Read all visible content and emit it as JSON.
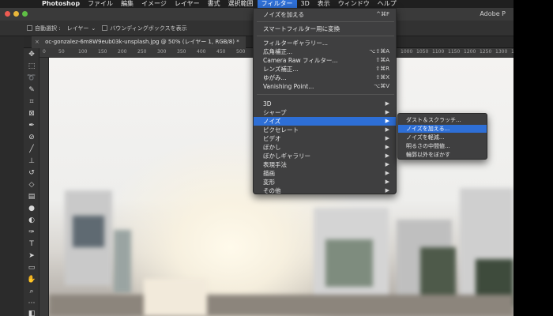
{
  "menubar": {
    "apple": "",
    "app_name": "Photoshop",
    "items": [
      "ファイル",
      "編集",
      "イメージ",
      "レイヤー",
      "書式",
      "選択範囲",
      "フィルター",
      "3D",
      "表示",
      "ウィンドウ",
      "ヘルプ"
    ]
  },
  "window": {
    "app_title": "Adobe P",
    "traffic_light_colors": [
      "#ee5b52",
      "#e9b73a",
      "#5fbf45"
    ]
  },
  "options_bar": {
    "auto_select_label": "自動選択 :",
    "auto_select_value": "レイヤー",
    "bbox_label": "バウンディングボックスを表示"
  },
  "document_tab": {
    "close": "×",
    "title": "oc-gonzalez-6m8W9eub03k-unsplash.jpg @ 50% (レイヤー 1, RGB/8) *"
  },
  "ruler": {
    "ticks": [
      "0",
      "50",
      "100",
      "150",
      "200",
      "250",
      "300",
      "350",
      "400",
      "450",
      "500",
      "550",
      "1000",
      "1050",
      "1100",
      "1150",
      "1200",
      "1250",
      "1300",
      "1350",
      "1400",
      "1450"
    ]
  },
  "tools": [
    "move-tool",
    "marquee-tool",
    "lasso-tool",
    "magic-wand-tool",
    "crop-tool",
    "frame-tool",
    "eyedropper-tool",
    "healing-brush-tool",
    "brush-tool",
    "clone-stamp-tool",
    "history-brush-tool",
    "eraser-tool",
    "gradient-tool",
    "blur-tool",
    "dodge-tool",
    "pen-tool",
    "type-tool",
    "path-selection-tool",
    "rectangle-tool",
    "hand-tool",
    "zoom-tool",
    "more-tools",
    "color-swatches"
  ],
  "filter_menu": {
    "items": [
      {
        "label": "ノイズを加える",
        "shortcut": "^⌘F"
      },
      {
        "label": "スマートフィルター用に変換",
        "shortcut": ""
      },
      {
        "label": "フィルターギャラリー...",
        "shortcut": ""
      },
      {
        "label": "広角補正...",
        "shortcut": "⌥⇧⌘A"
      },
      {
        "label": "Camera Raw フィルター...",
        "shortcut": "⇧⌘A"
      },
      {
        "label": "レンズ補正...",
        "shortcut": "⇧⌘R"
      },
      {
        "label": "ゆがみ...",
        "shortcut": "⇧⌘X"
      },
      {
        "label": "Vanishing Point...",
        "shortcut": "⌥⌘V"
      },
      {
        "label": "3D",
        "shortcut": ""
      },
      {
        "label": "シャープ",
        "shortcut": ""
      },
      {
        "label": "ノイズ",
        "shortcut": ""
      },
      {
        "label": "ピクセレート",
        "shortcut": ""
      },
      {
        "label": "ビデオ",
        "shortcut": ""
      },
      {
        "label": "ぼかし",
        "shortcut": ""
      },
      {
        "label": "ぼかしギャラリー",
        "shortcut": ""
      },
      {
        "label": "表現手法",
        "shortcut": ""
      },
      {
        "label": "描画",
        "shortcut": ""
      },
      {
        "label": "変形",
        "shortcut": ""
      },
      {
        "label": "その他",
        "shortcut": ""
      }
    ],
    "submenu_arrow": "▶"
  },
  "noise_submenu": {
    "items": [
      "ダスト＆スクラッチ...",
      "ノイズを加える...",
      "ノイズを軽減...",
      "明るさの中間値...",
      "輪郭以外をぼかす"
    ]
  },
  "colors": {
    "highlight": "#2e6fd6",
    "menu_bg": "#3f3f40"
  }
}
